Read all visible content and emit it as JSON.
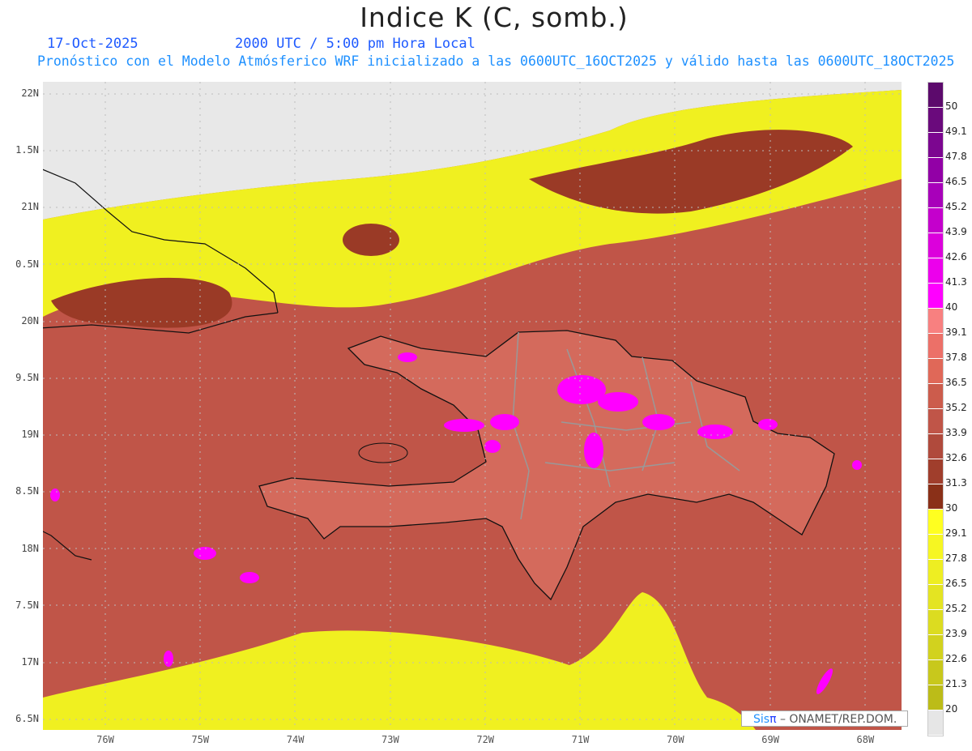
{
  "header": {
    "title": "Indice K (C, somb.)",
    "date": "17-Oct-2025",
    "time": "2000 UTC / 5:00 pm Hora Local",
    "subtitle": "Pronóstico con el Modelo Atmósferico WRF inicializado a las 0600UTC_16OCT2025 y válido hasta las  0600UTC_18OCT2025"
  },
  "axes": {
    "lat_labels": [
      "22N",
      "1.5N",
      "21N",
      "0.5N",
      "20N",
      "9.5N",
      "19N",
      "8.5N",
      "18N",
      "7.5N",
      "17N",
      "6.5N"
    ],
    "lon_labels": [
      "76W",
      "75W",
      "74W",
      "73W",
      "72W",
      "71W",
      "70W",
      "69W",
      "68W"
    ]
  },
  "colorbar": {
    "labels": [
      "50",
      "49.1",
      "47.8",
      "46.5",
      "45.2",
      "43.9",
      "42.6",
      "41.3",
      "40",
      "39.1",
      "37.8",
      "36.5",
      "35.2",
      "33.9",
      "32.6",
      "31.3",
      "30",
      "29.1",
      "27.8",
      "26.5",
      "25.2",
      "23.9",
      "22.6",
      "21.3",
      "20"
    ],
    "colors": [
      "#5c0a6c",
      "#6a0a7c",
      "#7c0690",
      "#9200a6",
      "#a800ba",
      "#c400cc",
      "#dc00dc",
      "#ec00ec",
      "#ff00ff",
      "#f88080",
      "#ec7068",
      "#e06858",
      "#cc5c4c",
      "#c05548",
      "#b04a3c",
      "#a03e2c",
      "#8a3018",
      "#ffff20",
      "#f6f622",
      "#eeee22",
      "#e4e422",
      "#dcdc20",
      "#d2d21e",
      "#c8c81c",
      "#bcbc18",
      "#e6e6e6"
    ]
  },
  "credit": {
    "sis": "Sis",
    "pi": "π",
    "org": " – ONAMET/REP.DOM."
  }
}
